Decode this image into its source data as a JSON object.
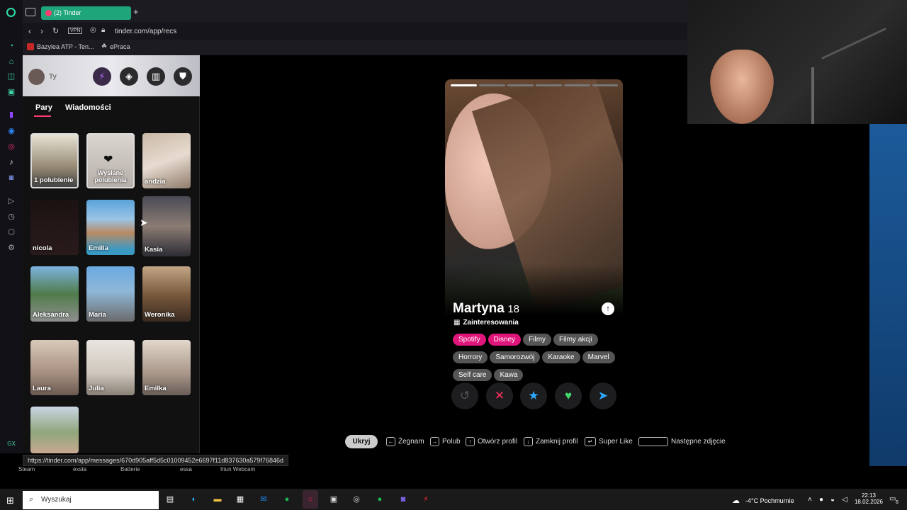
{
  "browser": {
    "tab_title": "(2) Tinder",
    "url": "tinder.com/app/recs",
    "vpn": "VPN",
    "bookmarks": [
      "Bazylea ATP - Ten...",
      "ePraca"
    ]
  },
  "sidebar": {
    "profile_label": "Ty",
    "tabs": [
      "Pary",
      "Wiadomości"
    ],
    "active_tab": "Pary",
    "tiles": [
      {
        "label": "1 polubienie"
      },
      {
        "label": "Wysłane polubienia"
      },
      {
        "label": "andzia"
      },
      {
        "label": "nicola"
      },
      {
        "label": "Emilia"
      },
      {
        "label": "Kasia"
      },
      {
        "label": "Aleksandra"
      },
      {
        "label": "Maria"
      },
      {
        "label": "Weronika"
      },
      {
        "label": "Laura"
      },
      {
        "label": "Julia"
      },
      {
        "label": "Emilka"
      },
      {
        "label": ""
      }
    ]
  },
  "card": {
    "name": "Martyna",
    "age": "18",
    "section": "Zainteresowania",
    "interests": [
      {
        "label": "Spotify",
        "shared": true
      },
      {
        "label": "Disney",
        "shared": true
      },
      {
        "label": "Filmy",
        "shared": false
      },
      {
        "label": "Filmy akcji",
        "shared": false
      },
      {
        "label": "Horrory",
        "shared": false
      },
      {
        "label": "Samorozwój",
        "shared": false
      },
      {
        "label": "Karaoke",
        "shared": false
      },
      {
        "label": "Marvel",
        "shared": false
      },
      {
        "label": "Self care",
        "shared": false
      },
      {
        "label": "Kawa",
        "shared": false
      }
    ],
    "photo_count": 6,
    "photo_index": 1
  },
  "shortcuts": {
    "hide": "Ukryj",
    "items": [
      "Żegnam",
      "Polub",
      "Otwórz profil",
      "Zamknij profil",
      "Super Like",
      "Następne zdjęcie"
    ]
  },
  "status_url": "https://tinder.com/app/messages/670d905aff5d5c01009452e6697f11d837630a579f76846d",
  "dock_labels": [
    "Steam",
    "exsta",
    "Batterie",
    "essa",
    "Iriun Webcam"
  ],
  "taskbar": {
    "search": "Wyszukaj",
    "weather": "-4°C Pochmurnie",
    "time": "22:13",
    "date": "18.02.2026",
    "notif": "6"
  },
  "colors": {
    "accent": "#fe3c72",
    "tab_green": "#1fa57a",
    "pill_pink": "#e0157a"
  }
}
